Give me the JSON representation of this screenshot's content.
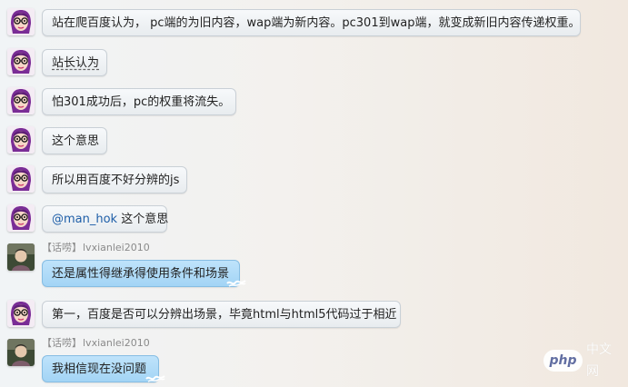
{
  "chat": {
    "messages": [
      {
        "type": "plain",
        "text": "站在爬百度认为， pc端的为旧内容，wap端为新内容。pc301到wap端，就变成新旧内容传递权重。"
      },
      {
        "type": "plain",
        "text": "站长认为"
      },
      {
        "type": "plain",
        "text": "怕301成功后，pc的权重将流失。"
      },
      {
        "type": "plain",
        "text": "这个意思"
      },
      {
        "type": "plain",
        "text": "所以用百度不好分辨的js"
      },
      {
        "type": "mention",
        "mention": "@man_hok",
        "text": " 这个意思"
      },
      {
        "type": "reply",
        "tag": "【话唠】",
        "nickname": "lvxianlei2010",
        "text": "还是属性得继承得使用条件和场景"
      },
      {
        "type": "plain",
        "text": "第一，百度是否可以分辨出场景，毕竟html与html5代码过于相近"
      },
      {
        "type": "reply",
        "tag": "【话唠】",
        "nickname": "lvxianlei2010",
        "text": "我相信现在没问题"
      }
    ]
  },
  "watermark": {
    "logo": "php",
    "text": "中文网"
  },
  "colors": {
    "bubble_gray": "#eef1f3",
    "bubble_blue": "#b7dff8",
    "mention": "#1f5fa8",
    "meta": "#8a8a8a"
  }
}
